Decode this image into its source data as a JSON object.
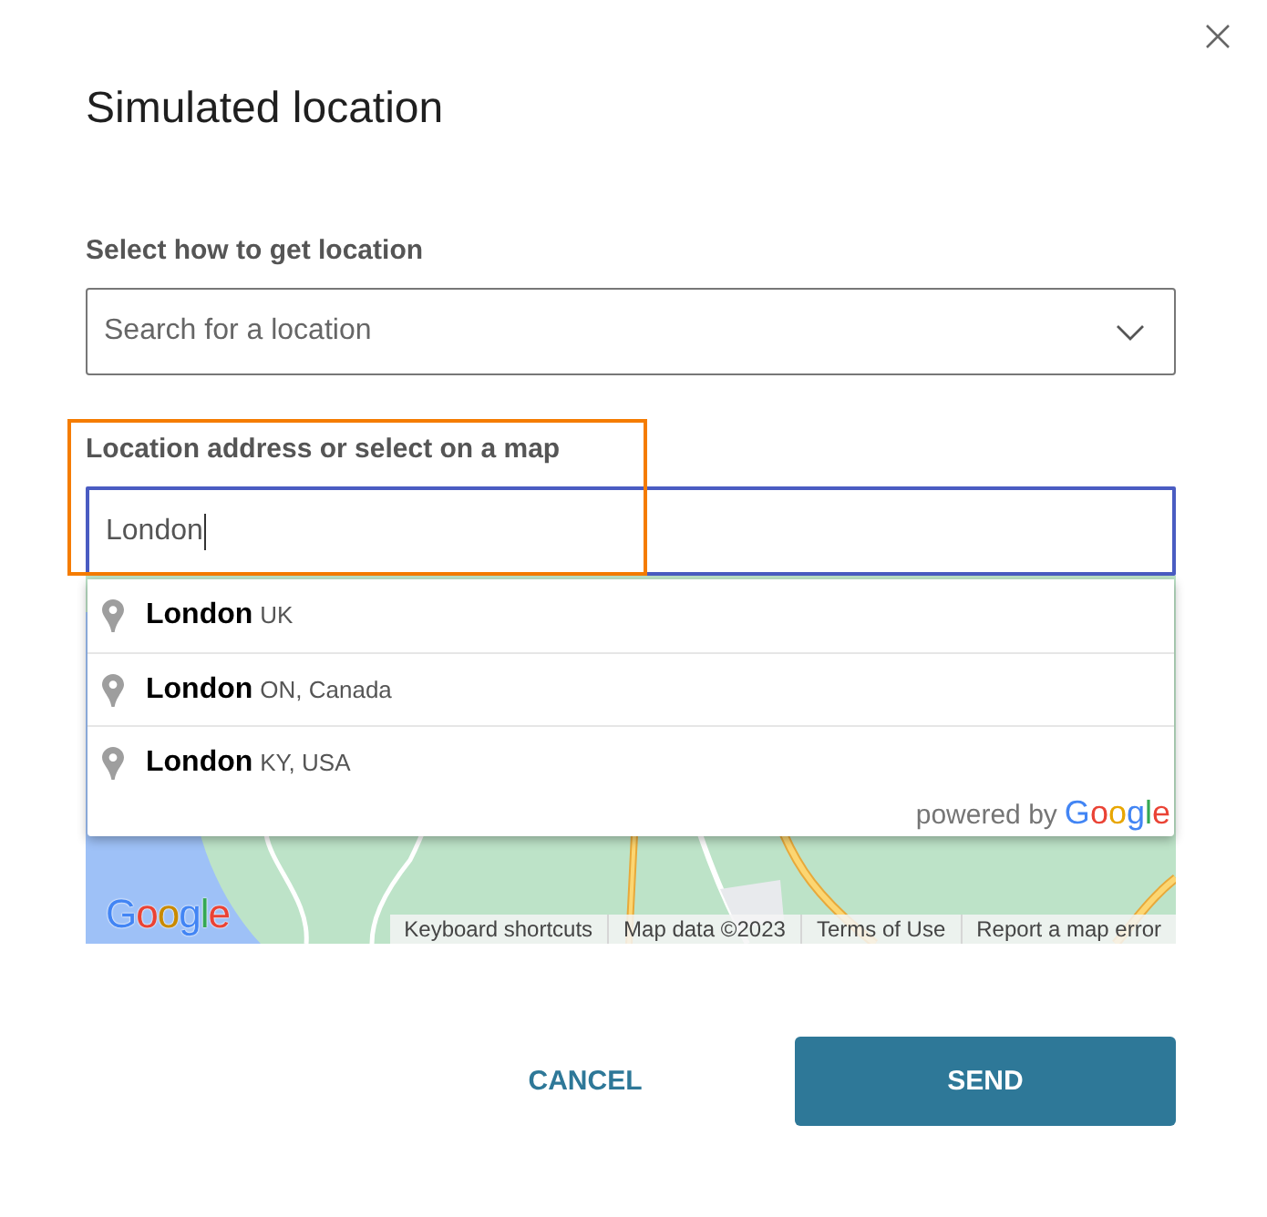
{
  "dialog": {
    "title": "Simulated location"
  },
  "method_field": {
    "label": "Select how to get location",
    "value": "Search for a location"
  },
  "address_field": {
    "label": "Location address or select on a map",
    "value": "London",
    "focused": true,
    "highlighted": true
  },
  "suggestions": [
    {
      "main": "London",
      "secondary": "UK",
      "selected": false
    },
    {
      "main": "London",
      "secondary": "ON, Canada",
      "selected": false
    },
    {
      "main": "London",
      "secondary": "KY, USA",
      "selected": false
    }
  ],
  "suggestions_footer": {
    "prefix": "powered by",
    "logo": "Google"
  },
  "map": {
    "logo": "Google",
    "attribution": [
      "Keyboard shortcuts",
      "Map data ©2023",
      "Terms of Use",
      "Report a map error"
    ]
  },
  "buttons": [
    {
      "label": "CANCEL",
      "kind": "secondary"
    },
    {
      "label": "SEND",
      "kind": "primary"
    }
  ]
}
